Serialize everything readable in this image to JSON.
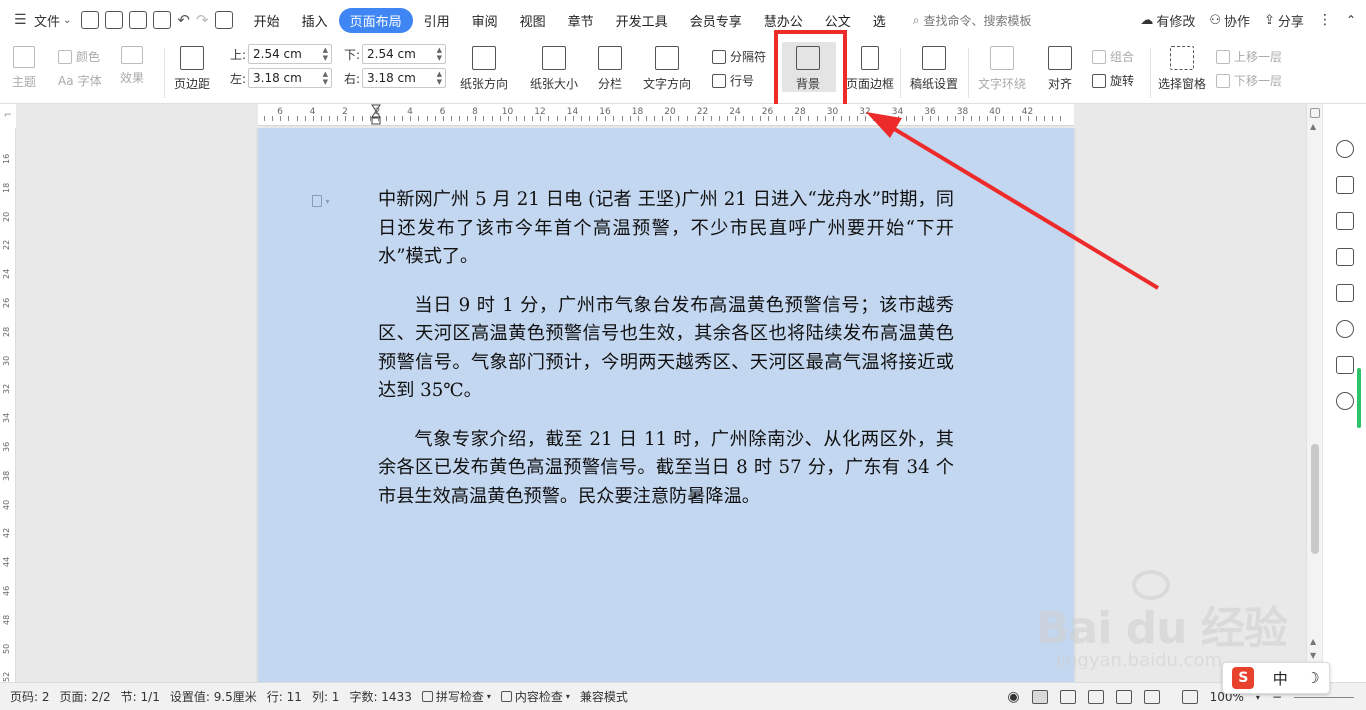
{
  "menubar": {
    "file_label": "文件",
    "tabs": [
      "开始",
      "插入",
      "页面布局",
      "引用",
      "审阅",
      "视图",
      "章节",
      "开发工具",
      "会员专享",
      "慧办公",
      "公文",
      "选"
    ],
    "active_tab": "页面布局",
    "search_placeholder": "查找命令、搜索模板",
    "has_changes": "有修改",
    "collab": "协作",
    "share": "分享"
  },
  "ribbon": {
    "theme": "主题",
    "color": "颜色",
    "font": "字体",
    "effect": "效果",
    "margin": "页边距",
    "top_label": "上:",
    "top_value": "2.54 cm",
    "bottom_label": "下:",
    "bottom_value": "2.54 cm",
    "left_label": "左:",
    "left_value": "3.18 cm",
    "right_label": "右:",
    "right_value": "3.18 cm",
    "orientation": "纸张方向",
    "size": "纸张大小",
    "columns": "分栏",
    "text_direction": "文字方向",
    "separator": "分隔符",
    "line_number": "行号",
    "background": "背景",
    "page_border": "页面边框",
    "manuscript": "稿纸设置",
    "text_wrap": "文字环绕",
    "align": "对齐",
    "group": "组合",
    "rotate": "旋转",
    "selection_pane": "选择窗格",
    "bring_forward": "上移一层",
    "send_backward": "下移一层"
  },
  "ruler": {
    "labels": [
      "6",
      "4",
      "2",
      "2",
      "4",
      "6",
      "8",
      "10",
      "12",
      "14",
      "16",
      "18",
      "20",
      "22",
      "24",
      "26",
      "28",
      "30",
      "32",
      "34",
      "36",
      "38",
      "40",
      "42"
    ],
    "vertical": [
      "16",
      "18",
      "20",
      "22",
      "24",
      "26",
      "28",
      "30",
      "32",
      "34",
      "36",
      "38",
      "40",
      "42",
      "44",
      "46",
      "48",
      "50",
      "52"
    ]
  },
  "document": {
    "paragraphs": [
      "中新网广州 5 月 21 日电 (记者 王坚)广州 21 日进入“龙舟水”时期，同日还发布了该市今年首个高温预警，不少市民直呼广州要开始“下开水”模式了。",
      "当日 9 时 1 分，广州市气象台发布高温黄色预警信号；该市越秀区、天河区高温黄色预警信号也生效，其余各区也将陆续发布高温黄色预警信号。气象部门预计，今明两天越秀区、天河区最高气温将接近或达到 35℃。",
      "气象专家介绍，截至 21 日 11 时，广州除南沙、从化两区外，其余各区已发布黄色高温预警信号。截至当日 8 时 57 分，广东有 34 个市县生效高温黄色预警。民众要注意防暑降温。"
    ],
    "background_color": "#c4d7f0"
  },
  "statusbar": {
    "page_num": "页码: 2",
    "pages": "页面: 2/2",
    "section": "节: 1/1",
    "setting": "设置值: 9.5厘米",
    "row": "行: 11",
    "col": "列: 1",
    "word_count": "字数: 1433",
    "spell_check": "拼写检查",
    "content_check": "内容检查",
    "compat_mode": "兼容模式",
    "zoom": "100%"
  },
  "ime": {
    "logo": "S",
    "mode": "中",
    "moon": "☽"
  },
  "watermark": {
    "main": "Bai du 经验",
    "sub": "jingyan.baidu.com"
  },
  "colors": {
    "accent": "#3f86f4",
    "highlight": "#ee2b2b",
    "page_bg": "#c4d7f0",
    "green": "#2cc36b"
  }
}
